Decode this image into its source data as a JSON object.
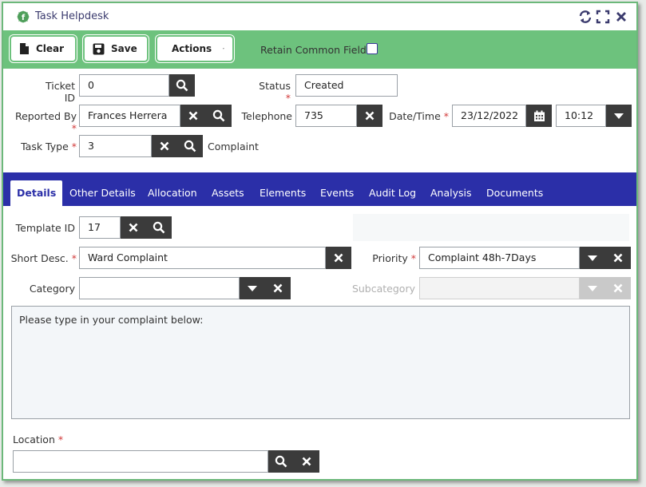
{
  "window": {
    "title": "Task Helpdesk"
  },
  "toolbar": {
    "clear_label": "Clear",
    "save_label": "Save",
    "actions_label": "Actions",
    "retain_label": "Retain Common Fields",
    "retain_checked": false
  },
  "header_form": {
    "ticket_id": {
      "label": "Ticket ID",
      "value": "0"
    },
    "status": {
      "label": "Status",
      "required": "*",
      "value": "Created"
    },
    "reported_by": {
      "label": "Reported By",
      "required": "*",
      "value": "Frances Herrera"
    },
    "telephone": {
      "label": "Telephone",
      "value": "735"
    },
    "datetime": {
      "label": "Date/Time",
      "required": "*",
      "date": "23/12/2022",
      "time": "10:12"
    },
    "task_type": {
      "label": "Task Type",
      "required": "*",
      "value": "3",
      "description": "Complaint"
    }
  },
  "tabs": [
    {
      "label": "Details",
      "active": true
    },
    {
      "label": "Other Details"
    },
    {
      "label": "Allocation"
    },
    {
      "label": "Assets"
    },
    {
      "label": "Elements"
    },
    {
      "label": "Events"
    },
    {
      "label": "Audit Log"
    },
    {
      "label": "Analysis"
    },
    {
      "label": "Documents"
    }
  ],
  "details": {
    "template_id": {
      "label": "Template ID",
      "value": "17"
    },
    "short_desc": {
      "label": "Short Desc.",
      "required": "*",
      "value": "Ward Complaint"
    },
    "priority": {
      "label": "Priority",
      "required": "*",
      "value": "Complaint 48h-7Days"
    },
    "category": {
      "label": "Category",
      "value": ""
    },
    "subcategory": {
      "label": "Subcategory",
      "value": ""
    },
    "complaint_text": "Please type in your complaint below:",
    "location": {
      "label": "Location",
      "required": "*",
      "value": ""
    }
  },
  "colors": {
    "toolbar_green": "#6dc27d",
    "tab_blue": "#2b2fa8",
    "button_dark": "#3b3b3b",
    "required_red": "#d23a3a"
  },
  "icons": [
    "app-logo-icon",
    "refresh-icon",
    "expand-icon",
    "close-icon",
    "document-icon",
    "save-disk-icon",
    "caret-down-icon",
    "search-icon",
    "clear-x-icon",
    "calendar-icon"
  ]
}
